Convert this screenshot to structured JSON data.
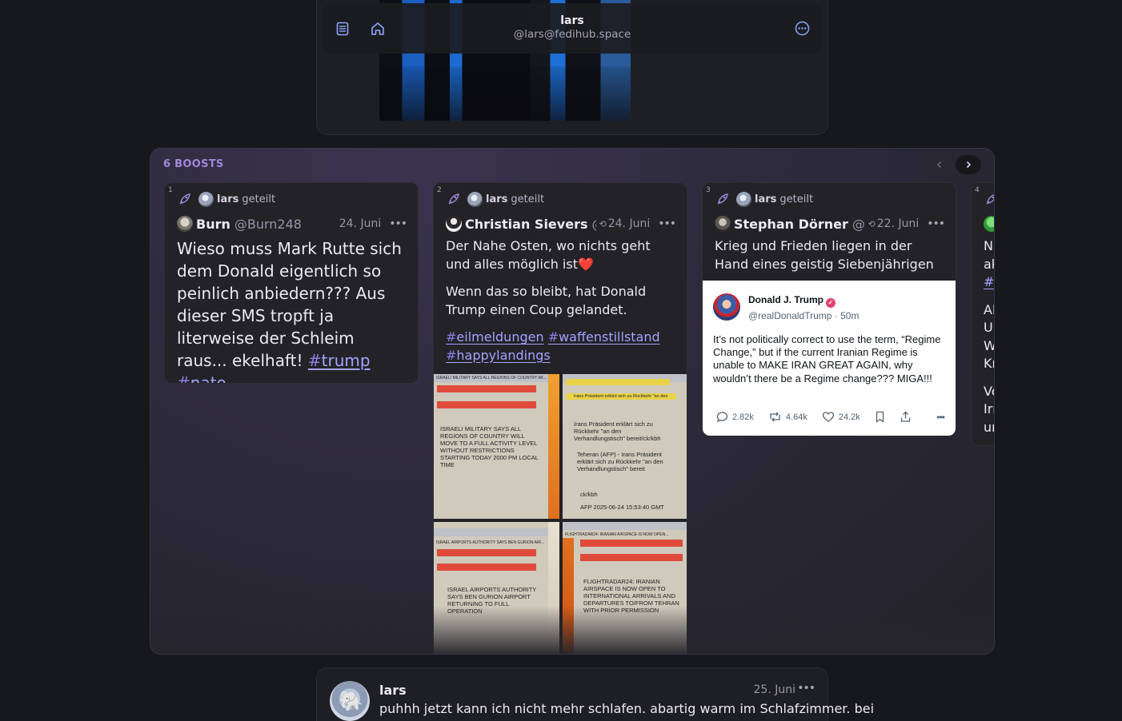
{
  "header": {
    "name": "lars",
    "handle": "@lars@fedihub.space",
    "icons": [
      "reader-view-icon",
      "home-icon",
      "more-options-icon"
    ]
  },
  "boosts": {
    "title": "6 BOOSTS",
    "cards": [
      {
        "index": "1",
        "sharer": "lars",
        "shared_label": "geteilt",
        "author_name": "Burn",
        "author_handle": "@Burn248",
        "date": "24. Juni",
        "paragraphs": [
          {
            "text": "Wieso muss Mark Rutte sich dem Donald eigentlich so peinlich anbiedern??? Aus dieser SMS tropft ja literweise der Schleim raus... ekelhaft!",
            "tags": [
              "trump",
              "nato"
            ]
          }
        ]
      },
      {
        "index": "2",
        "sharer": "lars",
        "shared_label": "geteilt",
        "author_name": "Christian Sievers",
        "author_handle": "@sie",
        "date": "24. Juni",
        "paragraphs": [
          {
            "text": "Der Nahe Osten, wo nichts geht und alles möglich ist",
            "emoji": "❤️"
          },
          {
            "text": "Wenn das so bleibt, hat Donald Trump einen Coup gelandet."
          },
          {
            "tags": [
              "eilmeldungen",
              "waffenstillstand",
              "happylandings"
            ]
          }
        ],
        "images": [
          {
            "header": "ISRAELI MILITARY SAYS ALL REGIONS OF COUNTRY WI...",
            "body": "ISRAELI MILITARY SAYS ALL REGIONS OF COUNTRY WILL MOVE TO A FULL ACTIVITY LEVEL WITHOUT RESTRICTIONS STARTING TODAY 2000 PM LOCAL TIME"
          },
          {
            "header": "Irans Präsident erklärt sich zu Rückkehr \"an den",
            "body": "Irans Präsident erklärt sich zu Rückkehr \"an den Verhandlungstisch\" bereit/ck/kbh",
            "body2": "Teheran (AFP) - Irans Präsident erklärt sich zu Rückkehr \"an den Verhandlungstisch\" bereit",
            "footer": "AFP 2025-06-24 15:53:40 GMT",
            "sig": "ck/kbh"
          },
          {
            "header": "ISRAEL AIRPORTS AUTHORITY SAYS BEN GURION AIR...",
            "body": "ISRAEL AIRPORTS AUTHORITY SAYS BEN GURION AIRPORT RETURNING TO FULL OPERATION"
          },
          {
            "header": "FLIGHTRADAR24: IRANIAN AIRSPACE IS NOW OPEN...",
            "body": "FLIGHTRADAR24: IRANIAN AIRSPACE IS NOW OPEN TO INTERNATIONAL ARRIVALS AND DEPARTURES TO/FROM TEHRAN WITH PRIOR PERMISSION"
          }
        ]
      },
      {
        "index": "3",
        "sharer": "lars",
        "shared_label": "geteilt",
        "author_name": "Stephan Dörner",
        "author_handle": "@doe",
        "date": "22. Juni",
        "paragraphs": [
          {
            "text": "Krieg und Frieden liegen in der Hand eines geistig Siebenjährigen"
          }
        ],
        "embed": {
          "name": "Donald J. Trump",
          "handle": "@realDonaldTrump",
          "age": "50m",
          "body": "It’s not politically correct to use the term, “Regime Change,” but if the current Iranian Regime is unable to MAKE IRAN GREAT AGAIN, why wouldn’t there be a Regime change??? MIGA!!!",
          "replies": "2.82k",
          "reblogs": "4.64k",
          "likes": "24.2k"
        }
      },
      {
        "index": "4",
        "lines": [
          "N",
          "ak",
          "#",
          "Al",
          "Ur",
          "W",
          "Kr",
          "Ve",
          "Irı",
          "ur"
        ]
      }
    ]
  },
  "next_status": {
    "name": "lars",
    "date": "25. Juni",
    "text": "puhhh jetzt kann ich nicht mehr schlafen. abartig warm im Schlafzimmer. bei"
  },
  "colors": {
    "accent": "#9d89d9",
    "hashtag": "#a5a2ff",
    "background": "#17181c",
    "card": "#232227"
  }
}
